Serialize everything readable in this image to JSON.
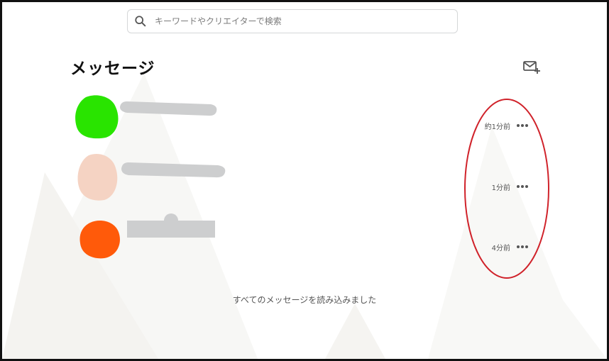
{
  "search": {
    "placeholder": "キーワードやクリエイターで検索",
    "icon": "search-icon"
  },
  "page": {
    "title": "メッセージ",
    "compose_icon": "mail-plus-icon"
  },
  "messages": [
    {
      "time": "約1分前",
      "avatar_color": "#29e400"
    },
    {
      "time": "1分前",
      "avatar_color": "#f5d3c3"
    },
    {
      "time": "4分前",
      "avatar_color": "#ff5a0a"
    }
  ],
  "footer": {
    "all_loaded": "すべてのメッセージを読み込みました"
  },
  "colors": {
    "annotation": "#d0222a",
    "redaction": "#cdcecf"
  }
}
